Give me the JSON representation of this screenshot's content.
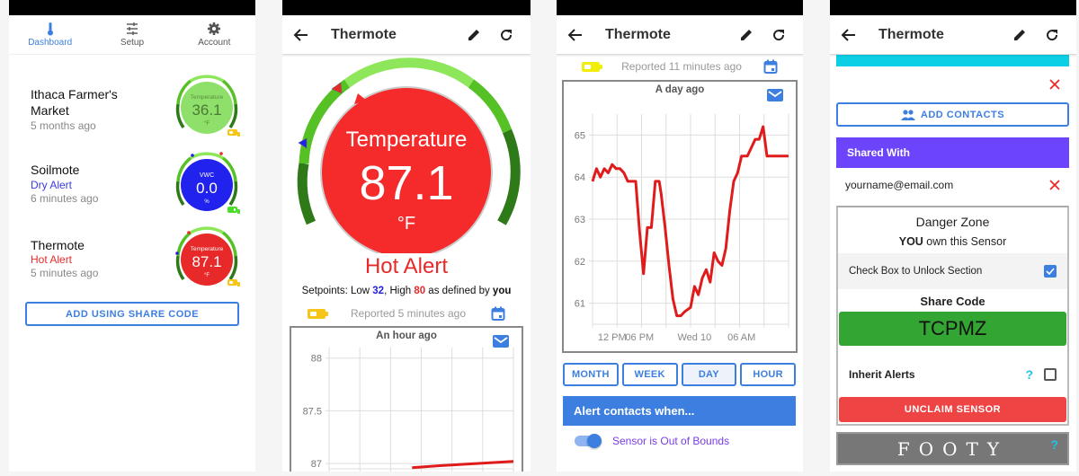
{
  "colors": {
    "accent": "#3d7fe0",
    "alert_red": "#e82929",
    "cold_blue": "#2222dd",
    "ok_green": "#8ee06a",
    "gauge_light": "#8ee65a",
    "gauge_mid": "#55c124",
    "gauge_dark": "#2e7a18",
    "battery_yellow": "#f5c518",
    "battery_bright_yellow": "#f2ee0c",
    "battery_green": "#4cdd2a",
    "contact_cyan": "#0ccfe6",
    "shared_purple": "#6c44fb",
    "share_green": "#33a532",
    "unclaim_red": "#ee4444"
  },
  "dashboard": {
    "tabs": [
      {
        "label": "Dashboard",
        "icon": "thermometer-icon",
        "active": true
      },
      {
        "label": "Setup",
        "icon": "sliders-icon",
        "active": false
      },
      {
        "label": "Account",
        "icon": "gear-icon",
        "active": false
      }
    ],
    "sensors": [
      {
        "name_line1": "Ithaca Farmer's",
        "name_line2": "Market",
        "status": "",
        "time": "5 months ago",
        "gauge_label": "Temperature",
        "gauge_value": "36.1",
        "gauge_unit": "°F",
        "battery": "yellow"
      },
      {
        "name_line1": "Soilmote",
        "name_line2": "",
        "status": "Dry Alert",
        "time": "6 minutes ago",
        "gauge_label": "VWC",
        "gauge_value": "0.0",
        "gauge_unit": "%",
        "battery": "green"
      },
      {
        "name_line1": "Thermote",
        "name_line2": "",
        "status": "Hot Alert",
        "time": "5 minutes ago",
        "gauge_label": "Temperature",
        "gauge_value": "87.1",
        "gauge_unit": "°F",
        "battery": "yellow"
      }
    ],
    "add_share_code_label": "ADD USING SHARE CODE"
  },
  "detail": {
    "title": "Thermote",
    "gauge_label": "Temperature",
    "gauge_value": "87.1",
    "gauge_unit": "°F",
    "alert_text": "Hot Alert",
    "setpoints_prefix": "Setpoints: Low ",
    "setpoint_low": "32",
    "setpoints_mid": ", High ",
    "setpoint_high": "80",
    "setpoints_suffix": " as defined by ",
    "setpoints_owner": "you",
    "reported": "Reported 5 minutes ago"
  },
  "day_view": {
    "title": "Thermote",
    "reported": "Reported 11 minutes ago",
    "range_buttons": [
      "MONTH",
      "WEEK",
      "DAY",
      "HOUR"
    ],
    "active_range": "DAY",
    "alert_header": "Alert contacts when...",
    "toggle_label": "Sensor is Out of Bounds",
    "toggle_on": true
  },
  "settings_view": {
    "title": "Thermote",
    "add_contacts_label": "ADD CONTACTS",
    "shared_with_header": "Shared With",
    "shared_email": "yourname@email.com",
    "danger_zone_title": "Danger Zone",
    "owner_bold": "YOU",
    "owner_rest": " own this Sensor",
    "unlock_label": "Check Box to Unlock Section",
    "unlock_checked": true,
    "share_code_label": "Share Code",
    "share_code": "TCPMZ",
    "inherit_alerts_label": "Inherit Alerts",
    "inherit_help": "?",
    "inherit_checked": false,
    "unclaim_label": "UNCLAIM SENSOR",
    "footy_label": "FOOTY",
    "footy_help": "?"
  },
  "chart_data": [
    {
      "type": "line",
      "title": "An hour ago",
      "xlabel": "",
      "ylabel": "",
      "ylim": [
        86.95,
        88.1
      ],
      "yticks": [
        "88",
        "87.5",
        "87"
      ],
      "ytick_values": [
        88,
        87.5,
        87
      ],
      "x": [
        0.45,
        0.6,
        0.8,
        1.0
      ],
      "values": [
        86.96,
        86.98,
        87.0,
        87.02
      ],
      "series_color": "#e01b1b",
      "grid": true
    },
    {
      "type": "line",
      "title": "A day ago",
      "xlabel": "",
      "ylabel": "",
      "ylim": [
        60.5,
        65.5
      ],
      "yticks": [
        "65",
        "64",
        "63",
        "62",
        "61"
      ],
      "ytick_values": [
        65,
        64,
        63,
        62,
        61
      ],
      "xticks": [
        "12 PM",
        "06 PM",
        "Wed 10",
        "06 AM"
      ],
      "xtick_positions": [
        0.1,
        0.24,
        0.52,
        0.76
      ],
      "x": [
        0.0,
        0.02,
        0.04,
        0.06,
        0.08,
        0.1,
        0.12,
        0.14,
        0.16,
        0.18,
        0.22,
        0.24,
        0.26,
        0.28,
        0.3,
        0.32,
        0.34,
        0.35,
        0.37,
        0.39,
        0.41,
        0.43,
        0.45,
        0.47,
        0.5,
        0.52,
        0.54,
        0.56,
        0.58,
        0.6,
        0.62,
        0.64,
        0.66,
        0.68,
        0.7,
        0.72,
        0.74,
        0.76,
        0.79,
        0.81,
        0.83,
        0.85,
        0.87,
        0.89,
        0.91,
        0.93,
        0.95,
        0.97,
        0.99,
        1.0
      ],
      "values": [
        63.9,
        64.2,
        64.0,
        64.2,
        64.1,
        64.3,
        64.2,
        64.2,
        64.1,
        63.9,
        63.9,
        62.7,
        61.7,
        62.8,
        62.8,
        63.9,
        63.9,
        63.6,
        62.8,
        61.9,
        61.1,
        60.7,
        60.7,
        60.8,
        60.9,
        61.4,
        61.2,
        61.6,
        61.8,
        61.5,
        62.2,
        62.0,
        61.9,
        62.3,
        63.2,
        63.9,
        64.1,
        64.5,
        64.5,
        64.7,
        64.9,
        64.9,
        65.2,
        64.5,
        64.5,
        64.5,
        64.5,
        64.5,
        64.5,
        64.5
      ],
      "series_color": "#e01b1b",
      "grid": true
    }
  ]
}
